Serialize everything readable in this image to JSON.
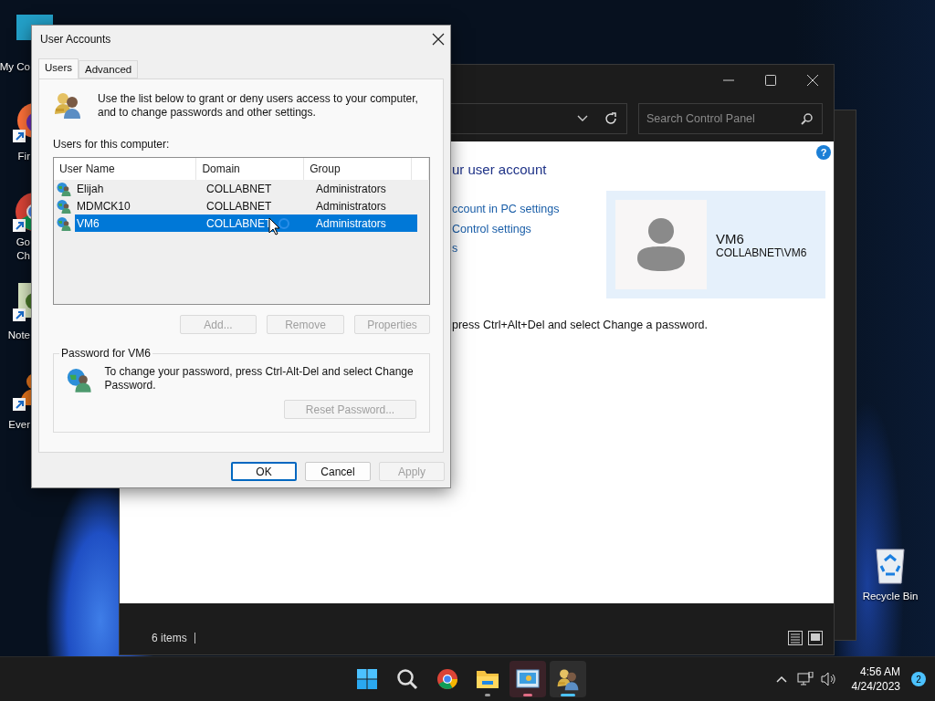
{
  "desktop_icons": [
    {
      "kind": "monitor",
      "lines": [
        "My Co"
      ],
      "shortcut": false
    },
    {
      "kind": "firefox",
      "lines": [
        "Fir"
      ],
      "shortcut": true
    },
    {
      "kind": "chrome",
      "lines": [
        "Go",
        "Ch"
      ],
      "shortcut": true
    },
    {
      "kind": "notepad",
      "lines": [
        "Note"
      ],
      "shortcut": true
    },
    {
      "kind": "orange",
      "lines": [
        "Ever"
      ],
      "shortcut": true
    }
  ],
  "recycle_bin": {
    "label": "Recycle Bin"
  },
  "control_panel": {
    "search_placeholder": "Search Control Panel",
    "help": "?",
    "heading": "ur user account",
    "links": [
      "ccount in PC settings",
      "Control settings",
      "s"
    ],
    "note": "press Ctrl+Alt+Del and select Change a password.",
    "user": {
      "name": "VM6",
      "account": "COLLABNET\\VM6"
    },
    "status": "6 items"
  },
  "dialog": {
    "title": "User Accounts",
    "tabs": [
      {
        "label": "Users",
        "selected": true
      },
      {
        "label": "Advanced",
        "selected": false
      }
    ],
    "description": "Use the list below to grant or deny users access to your computer, and to change passwords and other settings.",
    "list_label": "Users for this computer:",
    "columns": [
      "User Name",
      "Domain",
      "Group"
    ],
    "rows": [
      {
        "user_name": "Elijah",
        "domain": "COLLABNET",
        "group": "Administrators",
        "selected": false
      },
      {
        "user_name": "MDMCK10",
        "domain": "COLLABNET",
        "group": "Administrators",
        "selected": false
      },
      {
        "user_name": "VM6",
        "domain": "COLLABNET",
        "group": "Administrators",
        "selected": true
      }
    ],
    "list_buttons": [
      {
        "label": "Add...",
        "disabled": true
      },
      {
        "label": "Remove",
        "disabled": true
      },
      {
        "label": "Properties",
        "disabled": true
      }
    ],
    "password_group": {
      "title": "Password for VM6",
      "text": "To change your password, press Ctrl-Alt-Del and select Change Password.",
      "button": {
        "label": "Reset Password...",
        "disabled": true
      }
    },
    "buttons": [
      {
        "label": "OK",
        "disabled": false,
        "default": true
      },
      {
        "label": "Cancel",
        "disabled": false,
        "default": false
      },
      {
        "label": "Apply",
        "disabled": true,
        "default": false
      }
    ]
  },
  "taskbar": {
    "apps": [
      {
        "kind": "start",
        "running": false,
        "attention": false,
        "active": false
      },
      {
        "kind": "search",
        "running": false,
        "attention": false,
        "active": false
      },
      {
        "kind": "chrome",
        "running": false,
        "attention": false,
        "active": false
      },
      {
        "kind": "explorer",
        "running": true,
        "attention": false,
        "active": false
      },
      {
        "kind": "control_panel",
        "running": true,
        "attention": true,
        "active": false
      },
      {
        "kind": "users",
        "running": true,
        "attention": false,
        "active": true
      }
    ],
    "time": "4:56 AM",
    "date": "4/24/2023",
    "notifications": "2"
  }
}
